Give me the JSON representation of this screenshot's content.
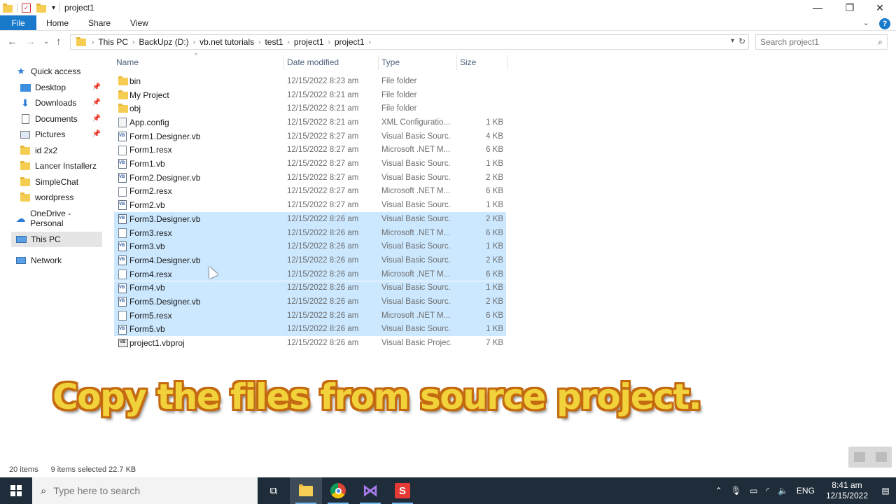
{
  "window": {
    "title": "project1",
    "minimize_glyph": "—",
    "maximize_glyph": "❐",
    "close_glyph": "✕"
  },
  "ribbon": {
    "tabs": [
      "File",
      "Home",
      "Share",
      "View"
    ],
    "expand_glyph": "⌄",
    "help_glyph": "?"
  },
  "address_bar": {
    "breadcrumbs": [
      "This PC",
      "BackUpz (D:)",
      "vb.net tutorials",
      "test1",
      "project1",
      "project1"
    ],
    "search_placeholder": "Search project1"
  },
  "nav_pane": {
    "items": [
      {
        "label": "Quick access",
        "icon": "star-icon",
        "pinned": false
      },
      {
        "label": "Desktop",
        "icon": "desktop-icon",
        "pinned": true
      },
      {
        "label": "Downloads",
        "icon": "download-icon",
        "pinned": true
      },
      {
        "label": "Documents",
        "icon": "documents-icon",
        "pinned": true
      },
      {
        "label": "Pictures",
        "icon": "pictures-icon",
        "pinned": true
      },
      {
        "label": "id 2x2",
        "icon": "folder-icon",
        "pinned": false
      },
      {
        "label": "Lancer Installerz",
        "icon": "folder-icon",
        "pinned": false
      },
      {
        "label": "SimpleChat",
        "icon": "folder-icon",
        "pinned": false
      },
      {
        "label": "wordpress",
        "icon": "folder-icon",
        "pinned": false
      },
      {
        "label": "OneDrive - Personal",
        "icon": "cloud-icon",
        "pinned": false
      },
      {
        "label": "This PC",
        "icon": "computer-icon",
        "pinned": false,
        "selected": true
      },
      {
        "label": "Network",
        "icon": "network-icon",
        "pinned": false
      }
    ]
  },
  "columns": {
    "name": "Name",
    "date": "Date modified",
    "type": "Type",
    "size": "Size"
  },
  "files": [
    {
      "name": "bin",
      "date": "12/15/2022 8:23 am",
      "type": "File folder",
      "size": "",
      "icon": "folder-icon",
      "selected": false
    },
    {
      "name": "My Project",
      "date": "12/15/2022 8:21 am",
      "type": "File folder",
      "size": "",
      "icon": "folder-icon",
      "selected": false
    },
    {
      "name": "obj",
      "date": "12/15/2022 8:21 am",
      "type": "File folder",
      "size": "",
      "icon": "folder-icon",
      "selected": false
    },
    {
      "name": "App.config",
      "date": "12/15/2022 8:21 am",
      "type": "XML Configuratio...",
      "size": "1 KB",
      "icon": "config-file-icon",
      "selected": false
    },
    {
      "name": "Form1.Designer.vb",
      "date": "12/15/2022 8:27 am",
      "type": "Visual Basic Sourc...",
      "size": "4 KB",
      "icon": "vb-file-icon",
      "selected": false
    },
    {
      "name": "Form1.resx",
      "date": "12/15/2022 8:27 am",
      "type": "Microsoft .NET M...",
      "size": "6 KB",
      "icon": "resx-file-icon",
      "selected": false
    },
    {
      "name": "Form1.vb",
      "date": "12/15/2022 8:27 am",
      "type": "Visual Basic Sourc...",
      "size": "1 KB",
      "icon": "vb-file-icon",
      "selected": false
    },
    {
      "name": "Form2.Designer.vb",
      "date": "12/15/2022 8:27 am",
      "type": "Visual Basic Sourc...",
      "size": "2 KB",
      "icon": "vb-file-icon",
      "selected": false
    },
    {
      "name": "Form2.resx",
      "date": "12/15/2022 8:27 am",
      "type": "Microsoft .NET M...",
      "size": "6 KB",
      "icon": "resx-file-icon",
      "selected": false
    },
    {
      "name": "Form2.vb",
      "date": "12/15/2022 8:27 am",
      "type": "Visual Basic Sourc...",
      "size": "1 KB",
      "icon": "vb-file-icon",
      "selected": false
    },
    {
      "name": "Form3.Designer.vb",
      "date": "12/15/2022 8:26 am",
      "type": "Visual Basic Sourc...",
      "size": "2 KB",
      "icon": "vb-file-icon",
      "selected": true
    },
    {
      "name": "Form3.resx",
      "date": "12/15/2022 8:26 am",
      "type": "Microsoft .NET M...",
      "size": "6 KB",
      "icon": "resx-file-icon",
      "selected": true
    },
    {
      "name": "Form3.vb",
      "date": "12/15/2022 8:26 am",
      "type": "Visual Basic Sourc...",
      "size": "1 KB",
      "icon": "vb-file-icon",
      "selected": true
    },
    {
      "name": "Form4.Designer.vb",
      "date": "12/15/2022 8:26 am",
      "type": "Visual Basic Sourc...",
      "size": "2 KB",
      "icon": "vb-file-icon",
      "selected": true
    },
    {
      "name": "Form4.resx",
      "date": "12/15/2022 8:26 am",
      "type": "Microsoft .NET M...",
      "size": "6 KB",
      "icon": "resx-file-icon",
      "selected": true
    },
    {
      "name": "Form4.vb",
      "date": "12/15/2022 8:26 am",
      "type": "Visual Basic Sourc...",
      "size": "1 KB",
      "icon": "vb-file-icon",
      "selected": true
    },
    {
      "name": "Form5.Designer.vb",
      "date": "12/15/2022 8:26 am",
      "type": "Visual Basic Sourc...",
      "size": "2 KB",
      "icon": "vb-file-icon",
      "selected": true
    },
    {
      "name": "Form5.resx",
      "date": "12/15/2022 8:26 am",
      "type": "Microsoft .NET M...",
      "size": "6 KB",
      "icon": "resx-file-icon",
      "selected": true
    },
    {
      "name": "Form5.vb",
      "date": "12/15/2022 8:26 am",
      "type": "Visual Basic Sourc...",
      "size": "1 KB",
      "icon": "vb-file-icon",
      "selected": true
    },
    {
      "name": "project1.vbproj",
      "date": "12/15/2022 8:26 am",
      "type": "Visual Basic Projec...",
      "size": "7 KB",
      "icon": "vbproj-file-icon",
      "selected": false
    }
  ],
  "caption": "Copy the files from source project.",
  "status": {
    "item_count": "20 items",
    "selection": "9 items selected  22.7 KB"
  },
  "taskbar": {
    "search_placeholder": "Type here to search",
    "apps": [
      "task-view-icon",
      "file-explorer-icon",
      "chrome-icon",
      "visual-studio-icon",
      "screen-recorder-icon"
    ],
    "language": "ENG",
    "time": "8:41 am",
    "date": "12/15/2022"
  },
  "colors": {
    "accent": "#1979ca",
    "selection": "#cce8ff",
    "taskbar": "#1f2d3a",
    "caption_fill": "#f2d23a",
    "caption_stroke": "#c46a10"
  }
}
